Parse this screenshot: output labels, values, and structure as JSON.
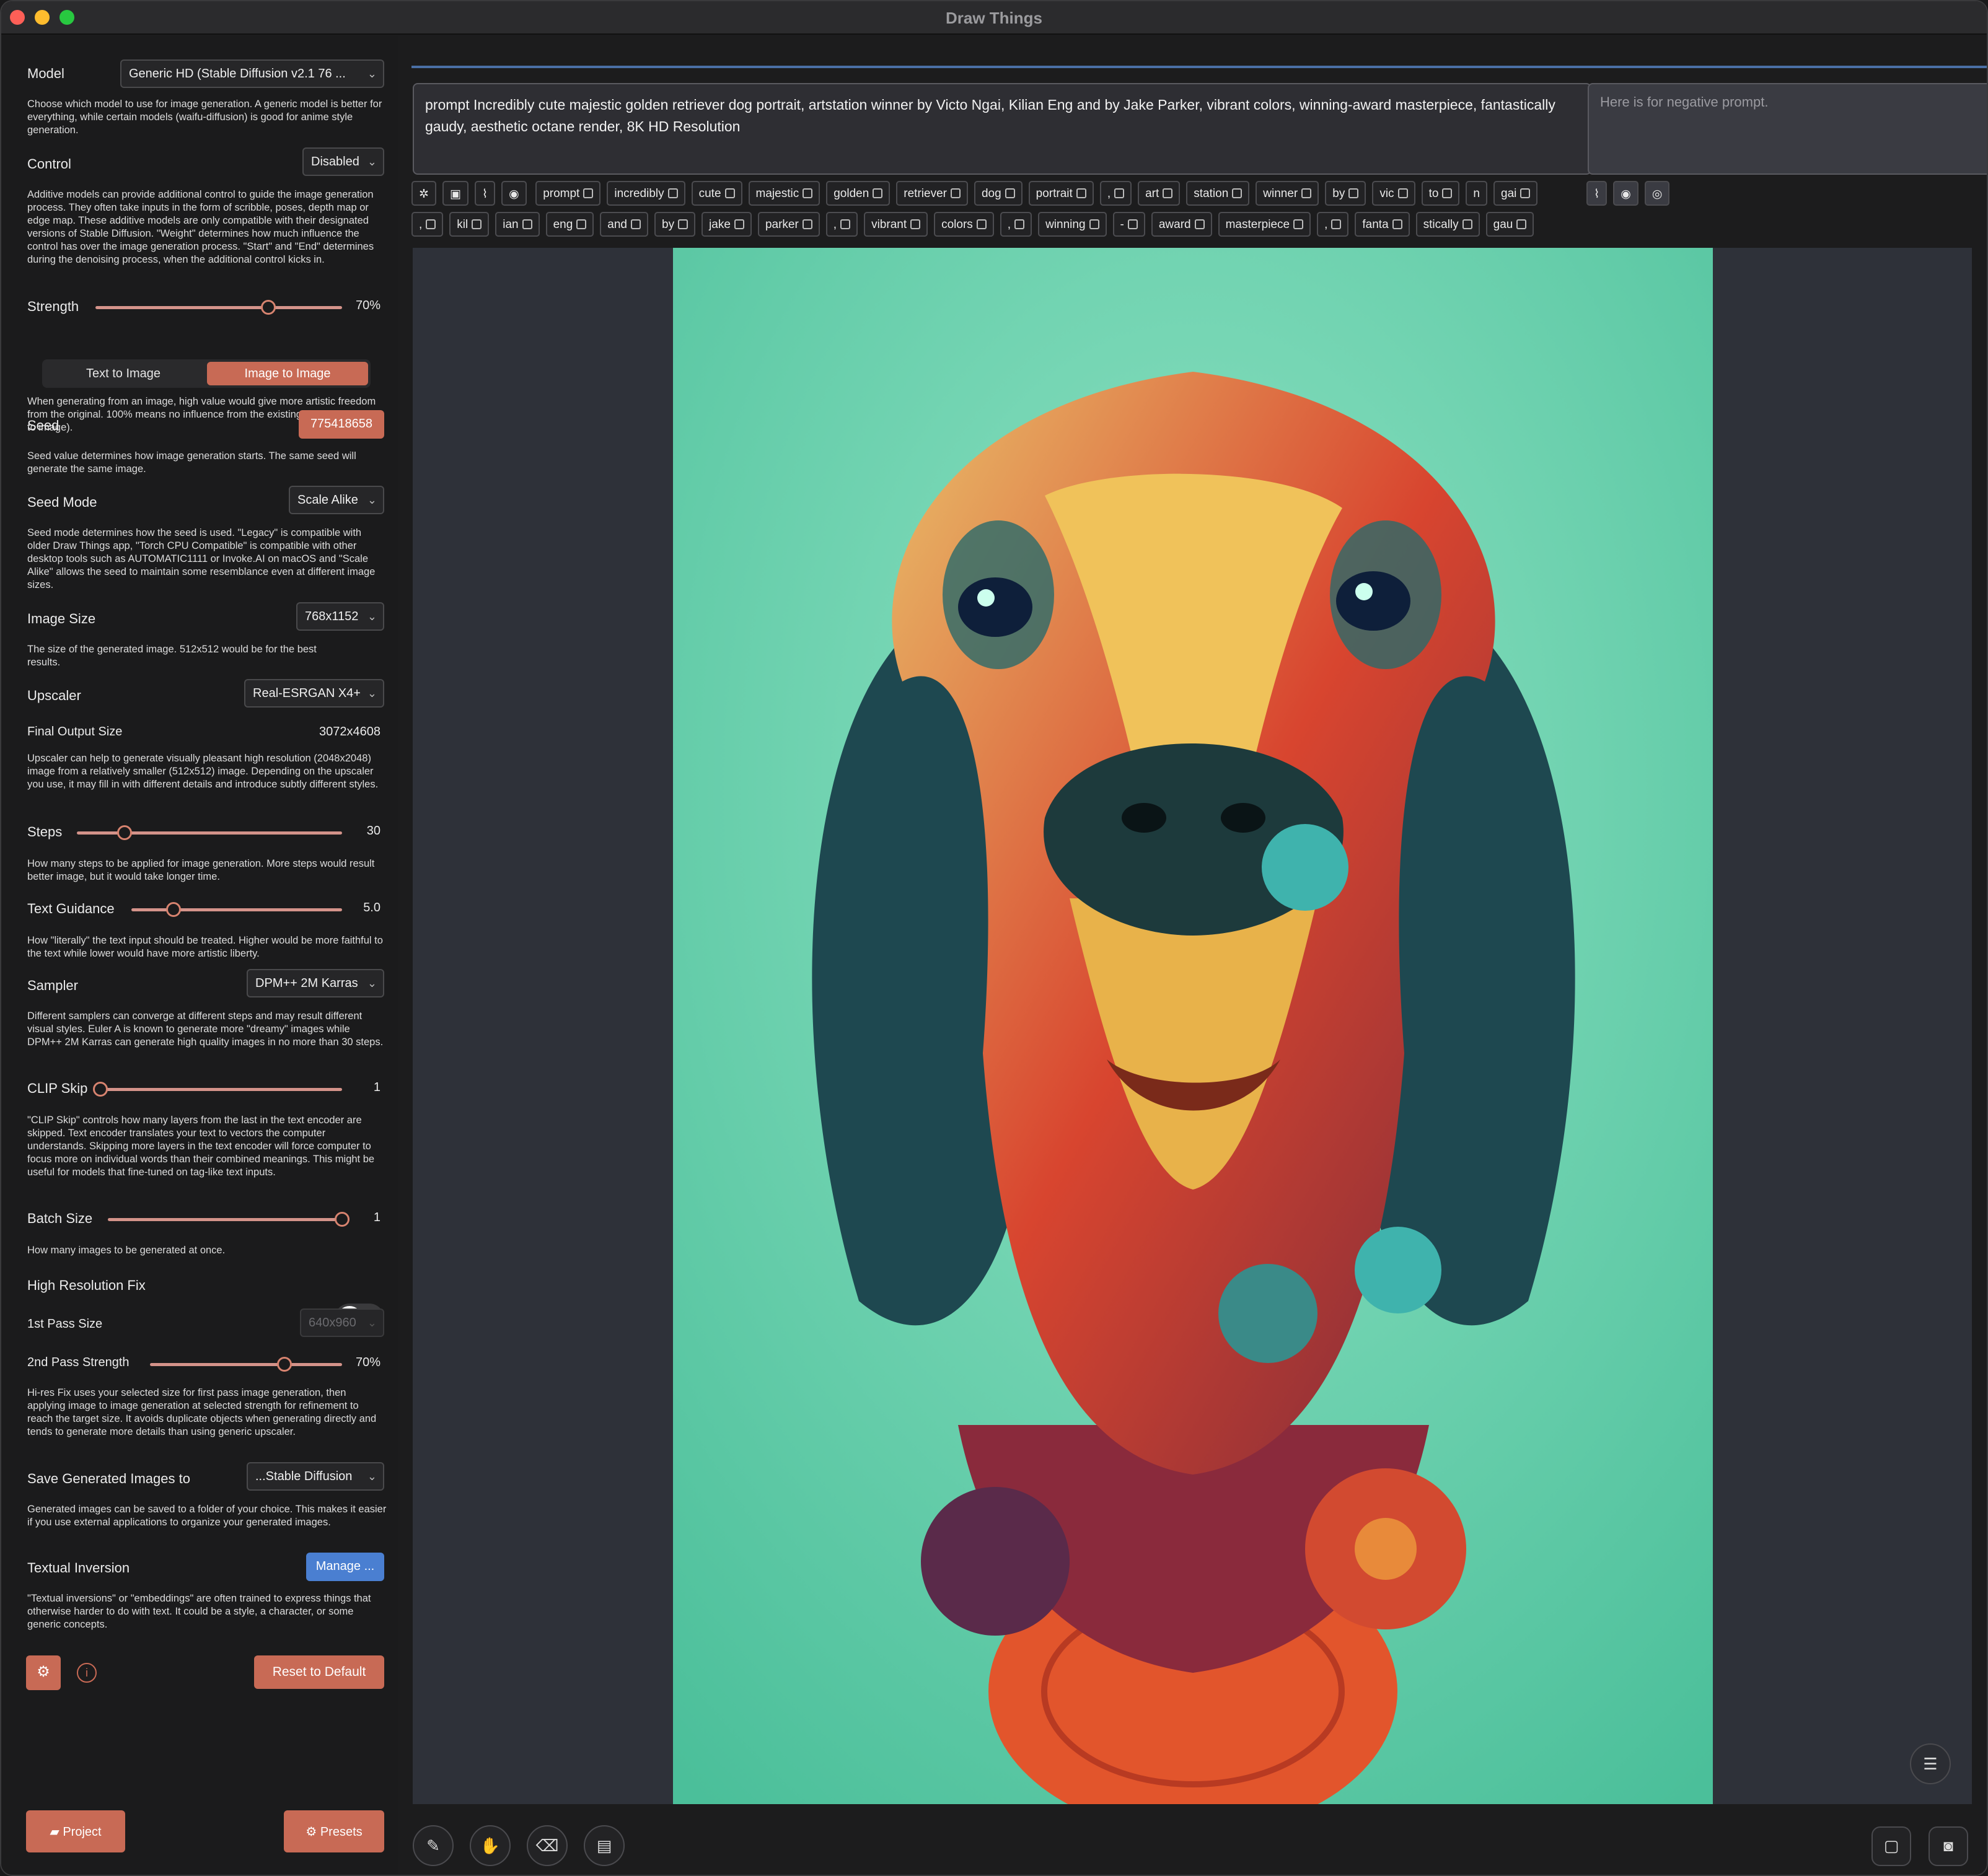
{
  "window": {
    "title": "Draw Things"
  },
  "sidebar": {
    "model": {
      "label": "Model",
      "value": "Generic HD (Stable Diffusion v2.1 76 ...",
      "desc": "Choose which model to use for image generation. A generic model is better for everything, while certain models (waifu-diffusion) is good for anime style generation."
    },
    "control": {
      "label": "Control",
      "value": "Disabled",
      "desc": "Additive models can provide additional control to guide the image generation process. They often take inputs in the form of scribble, poses, depth map or edge map. These additive models are only compatible with their designated versions of Stable Diffusion. \"Weight\" determines how much influence the control has over the image generation process. \"Start\" and \"End\" determines during the denoising process, when the additional control kicks in."
    },
    "strength": {
      "label": "Strength",
      "value": "70%",
      "level": 0.7
    },
    "mode": {
      "text_to_image": "Text to Image",
      "image_to_image": "Image to Image",
      "selected": "Image to Image",
      "desc": "When generating from an image, high value would give more artistic freedom from the original. 100% means no influence from the existing image (a.k.a. text to image)."
    },
    "seed": {
      "label": "Seed",
      "value": "775418658",
      "desc": "Seed value determines how image generation starts. The same seed will generate the same image."
    },
    "seed_mode": {
      "label": "Seed Mode",
      "value": "Scale Alike",
      "desc": "Seed mode determines how the seed is used. \"Legacy\" is compatible with older Draw Things app, \"Torch CPU Compatible\" is compatible with other desktop tools such as AUTOMATIC1111 or Invoke.AI on macOS and \"Scale Alike\" allows the seed to maintain some resemblance even at different image sizes."
    },
    "image_size": {
      "label": "Image Size",
      "value": "768x1152",
      "desc": "The size of the generated image. 512x512 would be for the best results."
    },
    "upscaler": {
      "label": "Upscaler",
      "value": "Real-ESRGAN X4+"
    },
    "final_output": {
      "label": "Final Output Size",
      "value": "3072x4608",
      "desc": "Upscaler can help to generate visually pleasant high resolution (2048x2048) image from a relatively smaller (512x512) image. Depending on the upscaler you use, it may fill in with different details and introduce subtly different styles."
    },
    "steps": {
      "label": "Steps",
      "value": "30",
      "level": 0.18,
      "desc": "How many steps to be applied for image generation. More steps would result better image, but it would take longer time."
    },
    "text_guidance": {
      "label": "Text Guidance",
      "value": "5.0",
      "level": 0.2,
      "desc": "How \"literally\" the text input should be treated. Higher would be more faithful to the text while lower would have more artistic liberty."
    },
    "sampler": {
      "label": "Sampler",
      "value": "DPM++ 2M Karras",
      "desc": "Different samplers can converge at different steps and may result different visual styles. Euler A is known to generate more \"dreamy\" images while DPM++ 2M Karras can generate high quality images in no more than 30 steps."
    },
    "clip_skip": {
      "label": "CLIP Skip",
      "value": "1",
      "level": 0.0,
      "desc": "\"CLIP Skip\" controls how many layers from the last in the text encoder are skipped. Text encoder translates your text to vectors the computer understands. Skipping more layers in the text encoder will force computer to focus more on individual words than their combined meanings. This might be useful for models that fine-tuned on tag-like text inputs."
    },
    "batch_size": {
      "label": "Batch Size",
      "value": "1",
      "level": 1.0,
      "desc": "How many images to be generated at once."
    },
    "hires_fix": {
      "label": "High Resolution Fix",
      "enabled": false
    },
    "first_pass": {
      "label": "1st Pass Size",
      "value": "640x960"
    },
    "second_pass": {
      "label": "2nd Pass Strength",
      "value": "70%",
      "level": 0.7,
      "desc": "Hi-res Fix uses your selected size for first pass image generation, then applying image to image generation at selected strength for refinement to reach the target size. It avoids duplicate objects when generating directly and tends to generate more details than using generic upscaler."
    },
    "save_to": {
      "label": "Save Generated Images to",
      "value": "...Stable Diffusion",
      "desc": "Generated images can be saved to a folder of your choice. This makes it easier if you use external applications to organize your generated images."
    },
    "textual_inversion": {
      "label": "Textual Inversion",
      "button": "Manage ...",
      "desc": "\"Textual inversions\" or \"embeddings\" are often trained to express things that otherwise harder to do with text. It could be a style, a character, or some generic concepts."
    },
    "reset_button": "Reset to Default",
    "project_button": "Project",
    "presets_button": "Presets"
  },
  "prompt": {
    "text": "prompt Incredibly cute majestic golden retriever dog portrait, artstation winner by Victo Ngai, Kilian Eng and by Jake Parker, vibrant colors, winning-award masterpiece, fantastically gaudy, aesthetic octane render, 8K HD Resolution",
    "negative_placeholder": "Here is for negative prompt."
  },
  "tokens_row1": [
    "prompt",
    "incredibly",
    "cute",
    "majestic",
    "golden",
    "retriever",
    "dog",
    "portrait",
    ",",
    "art",
    "station",
    "winner",
    "by",
    "vic",
    "to",
    "n",
    "gai"
  ],
  "tokens_row2": [
    ",",
    "kil",
    "ian",
    "eng",
    "and",
    "by",
    "jake",
    "parker",
    ",",
    "vibrant",
    "colors",
    ",",
    "winning",
    "-",
    "award",
    "masterpiece",
    ",",
    "fanta",
    "stically",
    "gau"
  ],
  "colors": {
    "accent": "#c86a55",
    "blue": "#4a7fd1",
    "canvas_bg": "#2e3139"
  }
}
